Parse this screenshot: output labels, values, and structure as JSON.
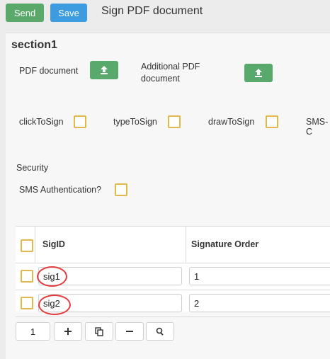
{
  "toolbar": {
    "send_label": "Send",
    "save_label": "Save",
    "title": "Sign PDF document"
  },
  "section": {
    "title": "section1"
  },
  "uploads": {
    "pdf_label": "PDF document",
    "additional_label_line1": "Additional PDF",
    "additional_label_line2": "document"
  },
  "sign_options": [
    "clickToSign",
    "typeToSign",
    "drawToSign",
    "SMS-C"
  ],
  "security": {
    "heading": "Security",
    "sms_label": "SMS Authentication?"
  },
  "table": {
    "columns": [
      "SigID",
      "Signature Order"
    ],
    "rows": [
      {
        "sigid": "sig1",
        "order": "1"
      },
      {
        "sigid": "sig2",
        "order": "2"
      }
    ]
  },
  "pager": {
    "page": "1"
  },
  "colors": {
    "send": "#5aa86a",
    "save": "#3d9be0",
    "upload": "#58a96b",
    "checkbox_border": "#e0b84d",
    "annotation": "#e23b3b"
  },
  "icons": [
    "upload-icon",
    "plus-icon",
    "copy-icon",
    "minus-icon",
    "search-icon"
  ]
}
